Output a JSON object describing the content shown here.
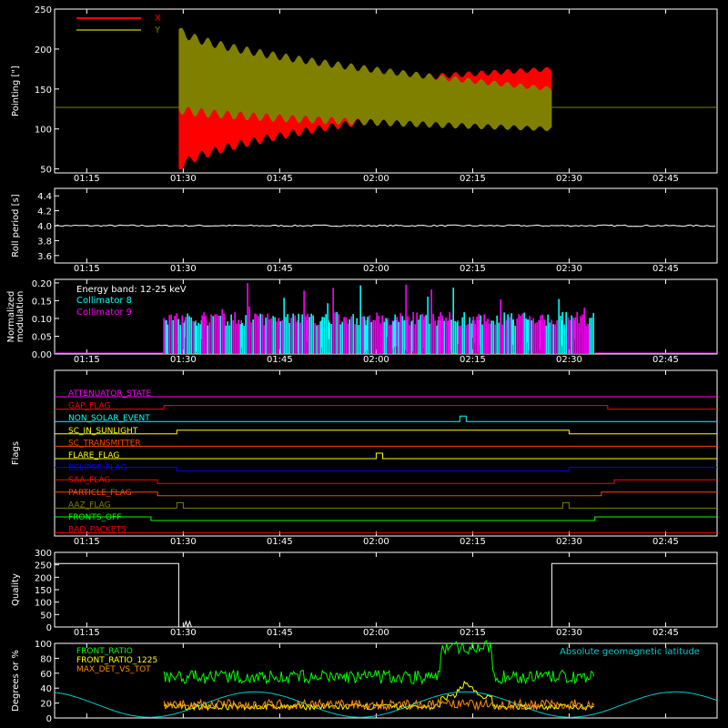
{
  "colors": {
    "background": "#000000",
    "axis": "#ffffff",
    "x_series": "#ff0000",
    "y_series": "#808000",
    "roll": "#ffffff",
    "coll8": "#00ffff",
    "coll9": "#ff00ff",
    "quality": "#ffffff",
    "front_ratio": "#00ff00",
    "front_ratio_1225": "#ffff00",
    "max_det": "#ff8c00",
    "geomag": "#00cccc"
  },
  "time_ticks": [
    "01:15",
    "01:30",
    "01:45",
    "02:00",
    "02:15",
    "02:30",
    "02:45"
  ],
  "chart_data": [
    {
      "id": "pointing",
      "type": "line",
      "ylabel": "Pointing [\"]",
      "ylim": [
        45,
        250
      ],
      "yticks": [
        "50",
        "100",
        "150",
        "200",
        "250"
      ],
      "legend": [
        "X",
        "Y"
      ],
      "baseline": 127,
      "active_range": [
        "01:29",
        "02:27"
      ],
      "series": [
        {
          "name": "X",
          "upper_start": 130,
          "upper_end": 175,
          "lower_start": 50,
          "lower_end": 140
        },
        {
          "name": "Y",
          "upper_start": 225,
          "upper_end": 150,
          "lower_start": 125,
          "lower_end": 100
        }
      ]
    },
    {
      "id": "roll",
      "type": "line",
      "ylabel": "Roll period [s]",
      "ylim": [
        3.5,
        4.5
      ],
      "yticks": [
        "3.6",
        "3.8",
        "4.0",
        "4.2",
        "4.4"
      ],
      "value": 4.0
    },
    {
      "id": "modulation",
      "type": "bar",
      "ylabel_lines": [
        "Normalized",
        "modulation"
      ],
      "ylim": [
        0,
        0.21
      ],
      "yticks": [
        "0.00",
        "0.05",
        "0.10",
        "0.15",
        "0.20"
      ],
      "annotation": "Energy band: 12-25 keV",
      "legend": [
        "Collimator 8",
        "Collimator 9"
      ],
      "active_range": [
        "01:27",
        "02:34"
      ],
      "typical_value": 0.095
    },
    {
      "id": "flags",
      "type": "line",
      "ylabel": "Flags",
      "flags": [
        {
          "name": "ATTENUATOR_STATE",
          "color": "#ff00ff",
          "steps": []
        },
        {
          "name": "GAP_FLAG",
          "color": "#ff0000",
          "steps": [
            [
              "01:27",
              1
            ],
            [
              "02:36",
              0
            ]
          ]
        },
        {
          "name": "NON_SOLAR_EVENT",
          "color": "#00ffff",
          "pulse": [
            "02:13",
            "02:14"
          ]
        },
        {
          "name": "SC_IN_SUNLIGHT",
          "color": "#ffff00",
          "steps": [
            [
              "01:29",
              1
            ],
            [
              "02:30",
              0
            ]
          ]
        },
        {
          "name": "SC_TRANSMITTER",
          "color": "#ff4500",
          "steps": []
        },
        {
          "name": "FLARE_FLAG",
          "color": "#ffff00",
          "pulse": [
            "02:00",
            "02:01"
          ]
        },
        {
          "name": "ECLIPSE_FLAG",
          "color": "#0000ff",
          "steps": [
            [
              "01:29",
              0
            ],
            [
              "02:30",
              1
            ]
          ]
        },
        {
          "name": "SAA_FLAG",
          "color": "#ff0000",
          "steps": [
            [
              "01:26",
              0
            ],
            [
              "02:37",
              1
            ]
          ]
        },
        {
          "name": "PARTICLE_FLAG",
          "color": "#ff4500",
          "steps": [
            [
              "01:26",
              0
            ],
            [
              "02:35",
              1
            ]
          ]
        },
        {
          "name": "AAZ_FLAG",
          "color": "#808000",
          "pulses": [
            [
              "01:29",
              "01:30"
            ],
            [
              "02:29",
              "02:30"
            ]
          ]
        },
        {
          "name": "FRONTS_OFF",
          "color": "#00ff00",
          "steps": [
            [
              "01:25",
              0
            ],
            [
              "02:34",
              1
            ]
          ]
        },
        {
          "name": "BAD_PACKETS",
          "color": "#ff0000",
          "steps": []
        }
      ]
    },
    {
      "id": "quality",
      "type": "line",
      "ylabel": "Quality",
      "ylim": [
        0,
        300
      ],
      "yticks": [
        "0",
        "50",
        "100",
        "150",
        "200",
        "250",
        "300"
      ],
      "high_value": 255,
      "low_range": [
        "01:29",
        "02:27"
      ]
    },
    {
      "id": "ratios",
      "type": "line",
      "ylabel": "Degrees or %",
      "ylim": [
        0,
        100
      ],
      "yticks": [
        "0",
        "20",
        "40",
        "60",
        "80",
        "100"
      ],
      "legend": [
        "FRONT_RATIO",
        "FRONT_RATIO_1225",
        "MAX_DET_VS_TOT"
      ],
      "annotation": "Absolute geomagnetic latitude",
      "active_range": [
        "01:27",
        "02:34"
      ],
      "front_ratio_typical": 55,
      "front_ratio_high": 95,
      "front_ratio_high_range": [
        "02:10",
        "02:18"
      ],
      "max_det_typical": 18
    }
  ]
}
